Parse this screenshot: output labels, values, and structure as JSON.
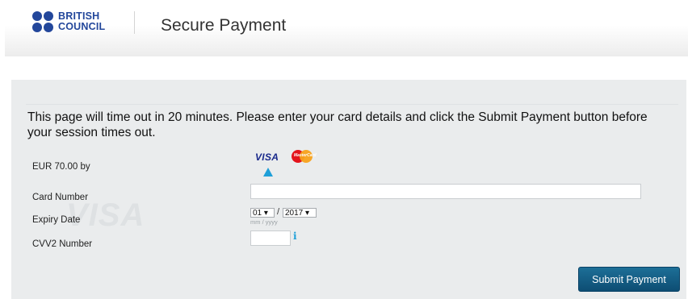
{
  "header": {
    "logo_line1": "BRITISH",
    "logo_line2": "COUNCIL",
    "title": "Secure Payment"
  },
  "notice": "This page will time out in 20 minutes. Please enter your card details and click the Submit Payment button before your session times out.",
  "payment": {
    "amount_label": "EUR 70.00 by",
    "card_types": [
      "VISA",
      "MasterCard"
    ],
    "selected_card": "VISA",
    "watermark": "VISA"
  },
  "fields": {
    "card_number_label": "Card Number",
    "card_number_value": "",
    "expiry_label": "Expiry Date",
    "expiry_month": "01 ▾",
    "expiry_separator": "/",
    "expiry_year": "2017 ▾",
    "expiry_hint": "mm / yyyy",
    "cvv_label": "CVV2 Number",
    "cvv_value": "",
    "info_icon": "i"
  },
  "actions": {
    "submit_label": "Submit Payment"
  },
  "colors": {
    "brand_blue": "#23479b",
    "panel_bg": "#eaeced",
    "button_bg": "#0d4d73",
    "accent": "#1e9fd8"
  },
  "icons": [
    "british-council-logo",
    "visa-icon",
    "mastercard-icon",
    "selected-arrow-icon",
    "info-icon"
  ]
}
